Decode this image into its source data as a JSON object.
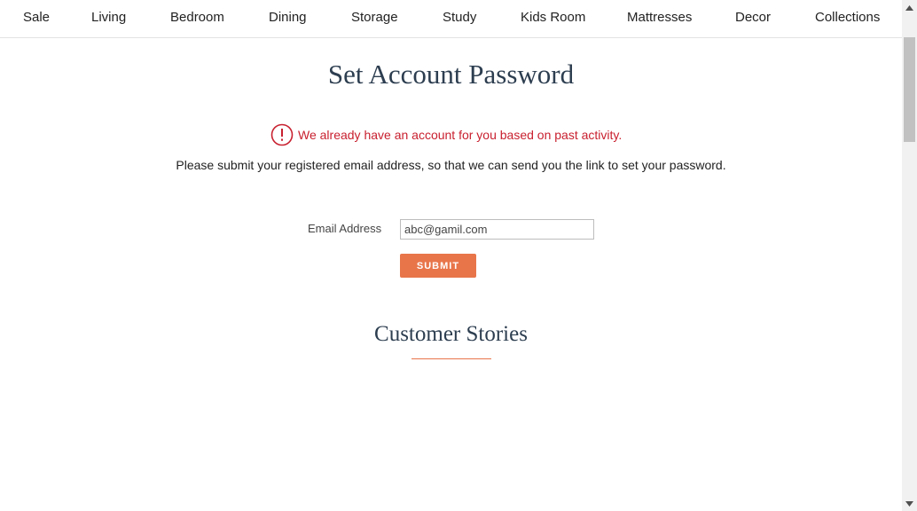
{
  "nav": {
    "items": [
      {
        "label": "Sale"
      },
      {
        "label": "Living"
      },
      {
        "label": "Bedroom"
      },
      {
        "label": "Dining"
      },
      {
        "label": "Storage"
      },
      {
        "label": "Study"
      },
      {
        "label": "Kids Room"
      },
      {
        "label": "Mattresses"
      },
      {
        "label": "Decor"
      },
      {
        "label": "Collections"
      }
    ]
  },
  "page": {
    "title": "Set Account Password",
    "alert_icon": "exclamation-circle-icon",
    "alert_text": "We already have an account for you based on past activity.",
    "instructions": "Please submit your registered email address, so that we can send you the link to set your password."
  },
  "form": {
    "email_label": "Email Address",
    "email_value": "abc@gamil.com",
    "submit_label": "SUBMIT"
  },
  "stories": {
    "title": "Customer Stories"
  },
  "colors": {
    "accent": "#e8754a",
    "alert": "#c8202f",
    "heading": "#2d3e50"
  }
}
